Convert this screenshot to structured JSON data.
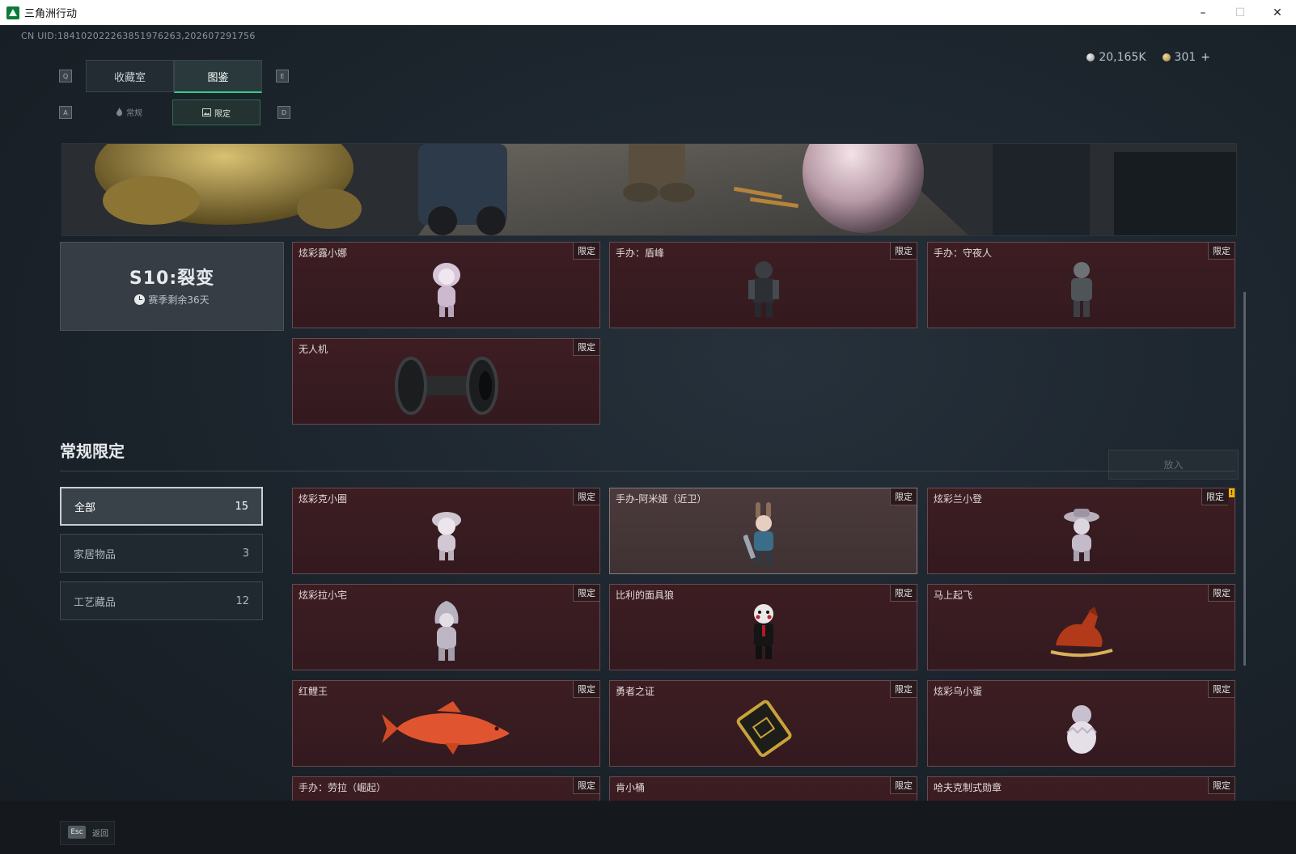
{
  "window": {
    "title": "三角洲行动",
    "minimize": "–",
    "maximize": "☐",
    "close": "✕"
  },
  "uid_text": "CN UID:184102022263851976263,202607291756",
  "key_hints": {
    "prev_tab": "Q",
    "next_tab": "E",
    "prev_sub": "A",
    "next_sub": "D"
  },
  "tabs": [
    {
      "label": "收藏室",
      "active": false
    },
    {
      "label": "图鉴",
      "active": true
    }
  ],
  "subtabs": [
    {
      "label": "常规",
      "active": false,
      "icon": "flame-icon"
    },
    {
      "label": "限定",
      "active": true,
      "icon": "image-icon"
    }
  ],
  "currency": {
    "silver": "20,165K",
    "gold": "301",
    "plus": "+"
  },
  "season": {
    "title": "S10:裂变",
    "remaining": "赛季剩余36天"
  },
  "season_items": [
    {
      "name": "炫彩露小娜",
      "badge": "限定",
      "art": "figure-pink-icon"
    },
    {
      "name": "手办：盾峰",
      "badge": "限定",
      "art": "figure-armor-icon"
    },
    {
      "name": "手办：守夜人",
      "badge": "限定",
      "art": "figure-dark-icon"
    },
    {
      "name": "无人机",
      "badge": "限定",
      "art": "drone-roller-icon"
    }
  ],
  "section": {
    "title": "常规限定",
    "put_in": "放入"
  },
  "filters": [
    {
      "label": "全部",
      "count": "15",
      "active": true
    },
    {
      "label": "家居物品",
      "count": "3",
      "active": false
    },
    {
      "label": "工艺藏品",
      "count": "12",
      "active": false
    }
  ],
  "items": [
    {
      "name": "炫彩克小圈",
      "badge": "限定",
      "art": "figure-girl-icon"
    },
    {
      "name": "手办-阿米娅（近卫）",
      "badge": "限定",
      "art": "figure-bunny-icon",
      "highlight": true
    },
    {
      "name": "炫彩兰小登",
      "badge": "限定",
      "art": "figure-hat-icon",
      "alert": "!"
    },
    {
      "name": "炫彩拉小宅",
      "badge": "限定",
      "art": "figure-hood-icon"
    },
    {
      "name": "比利的面具狼",
      "badge": "限定",
      "art": "puppet-icon"
    },
    {
      "name": "马上起飞",
      "badge": "限定",
      "art": "horse-icon"
    },
    {
      "name": "红鲤王",
      "badge": "限定",
      "art": "carp-icon"
    },
    {
      "name": "勇者之证",
      "badge": "限定",
      "art": "card-icon"
    },
    {
      "name": "炫彩乌小蛋",
      "badge": "限定",
      "art": "egg-icon"
    },
    {
      "name": "手办：劳拉（崛起）",
      "badge": "限定",
      "art": "figure-icon"
    },
    {
      "name": "肯小桶",
      "badge": "限定",
      "art": "bucket-icon"
    },
    {
      "name": "哈夫克制式勋章",
      "badge": "限定",
      "art": "medal-icon"
    }
  ],
  "footer": {
    "esc": "Esc",
    "back": "返回"
  },
  "colors": {
    "accent": "#2fd08a",
    "card_bg": "#3c1d22",
    "card_border": "#6b4a4f"
  }
}
